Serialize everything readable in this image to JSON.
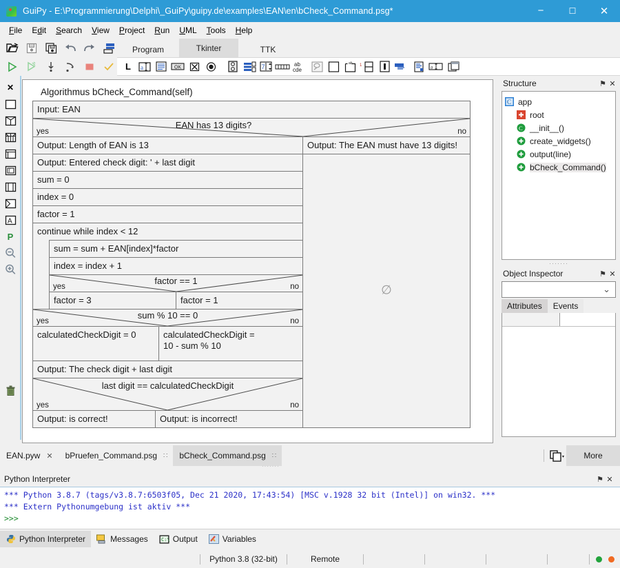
{
  "window": {
    "title": "GuiPy - E:\\Programmierung\\Delphi\\_GuiPy\\guipy.de\\examples\\EAN\\en\\bCheck_Command.psg*",
    "minimize": "─",
    "maximize": "☐",
    "close": "✕"
  },
  "menubar": {
    "items": [
      "File",
      "Edit",
      "Search",
      "View",
      "Project",
      "Run",
      "UML",
      "Tools",
      "Help"
    ]
  },
  "toolbar": {
    "row1": [
      "open-folder-icon",
      "save-icon",
      "save-all-icon",
      "undo-icon",
      "redo-icon",
      "layers-icon"
    ],
    "row2": [
      "run-icon",
      "debug-icon",
      "step-into-icon",
      "step-over-icon",
      "stop-icon",
      "check-icon"
    ]
  },
  "widget_tabs": {
    "items": [
      "Program",
      "Tkinter",
      "TTK"
    ],
    "active": "Tkinter"
  },
  "widget_toolbar": {
    "icons": [
      "label-icon",
      "entry-icon",
      "text-icon",
      "button-icon",
      "checkbox-icon",
      "radiobutton-icon",
      "listbox-icon",
      "scale-icon",
      "spinbox-icon",
      "scrollbar-icon",
      "abcde-icon",
      "canvas-icon",
      "frame-icon",
      "labelframe-icon",
      "panedwindow-icon",
      "notebook-icon",
      "menu-icon",
      "menubutton-icon",
      "combobox-icon",
      "toplevel-icon"
    ]
  },
  "palette": {
    "items": [
      {
        "name": "close-icon",
        "glyph": "✕"
      },
      {
        "name": "statement-block-icon",
        "glyph": "box"
      },
      {
        "name": "if-block-icon",
        "glyph": "if"
      },
      {
        "name": "case-block-icon",
        "glyph": "case"
      },
      {
        "name": "while-block-icon",
        "glyph": "while"
      },
      {
        "name": "for-block-icon",
        "glyph": "for"
      },
      {
        "name": "repeat-block-icon",
        "glyph": "repeat"
      },
      {
        "name": "subprogram-block-icon",
        "glyph": "sub"
      },
      {
        "name": "text-block-icon",
        "glyph": "A"
      },
      {
        "name": "python-mode-icon",
        "glyph": "P"
      },
      {
        "name": "zoom-out-icon",
        "glyph": "zoomout"
      },
      {
        "name": "zoom-in-icon",
        "glyph": "zoomin"
      },
      {
        "name": "delete-icon",
        "glyph": "trash"
      }
    ]
  },
  "diagram": {
    "title": "Algorithmus  bCheck_Command(self)",
    "empty_symbol": "∅",
    "rows": [
      {
        "kind": "stmt",
        "text": "Input: EAN"
      },
      {
        "kind": "decision",
        "cond": "EAN has 13 digits?",
        "yes": "yes",
        "no": "no"
      },
      {
        "kind": "branch_start",
        "left": "Output: Length of EAN is 13",
        "right": "Output: The EAN must have 13 digits!"
      },
      {
        "kind": "stmt",
        "text": "Output: Entered check digit: ' + last digit"
      },
      {
        "kind": "stmt",
        "text": "sum = 0"
      },
      {
        "kind": "stmt",
        "text": "index = 0"
      },
      {
        "kind": "stmt",
        "text": "factor = 1"
      },
      {
        "kind": "loop",
        "text": "continue while index < 12"
      },
      {
        "kind": "stmt_nested",
        "text": "sum = sum + EAN[index]*factor"
      },
      {
        "kind": "stmt_nested",
        "text": "index = index + 1"
      },
      {
        "kind": "decision_nested",
        "cond": "factor == 1",
        "yes": "yes",
        "no": "no"
      },
      {
        "kind": "split_nested",
        "left": "factor = 3",
        "right": "factor = 1"
      },
      {
        "kind": "decision",
        "cond": "sum % 10 == 0",
        "yes": "yes",
        "no": "no"
      },
      {
        "kind": "split",
        "left": "calculatedCheckDigit = 0",
        "right": "calculatedCheckDigit =\n10 - sum % 10"
      },
      {
        "kind": "stmt",
        "text": "Output: The check digit + last digit"
      },
      {
        "kind": "decision_tall",
        "cond": "last digit == calculatedCheckDigit",
        "yes": "yes",
        "no": "no"
      },
      {
        "kind": "split",
        "left": "Output:  is correct!",
        "right": "Output: is incorrect!"
      }
    ],
    "cells": {
      "input_ean": "Input: EAN",
      "cond_digits": "EAN has 13 digits?",
      "yes": "yes",
      "no": "no",
      "len_ok": "Output: Length of EAN is 13",
      "len_bad": "Output: The EAN must have 13 digits!",
      "entered_check": "Output: Entered check digit: ' + last digit",
      "sum0": "sum = 0",
      "index0": "index = 0",
      "factor1": "factor = 1",
      "while_loop": "continue while index < 12",
      "sum_add": "sum = sum + EAN[index]*factor",
      "index_inc": "index = index + 1",
      "cond_factor": "factor == 1",
      "factor3": "factor = 3",
      "factor1b": "factor = 1",
      "cond_mod": "sum % 10 == 0",
      "ccd0": "calculatedCheckDigit = 0",
      "ccd_line1": "calculatedCheckDigit =",
      "ccd_line2": "10 - sum % 10",
      "out_check": "Output: The check digit + last digit",
      "cond_last": "last digit == calculatedCheckDigit",
      "correct": "Output:  is correct!",
      "incorrect": "Output: is incorrect!"
    }
  },
  "structure": {
    "title": "Structure",
    "pin": "⚑",
    "close": "✕",
    "nodes": [
      {
        "label": "app",
        "icon": "class-icon",
        "indent": 0
      },
      {
        "label": "root",
        "icon": "field-icon",
        "indent": 1
      },
      {
        "label": "__init__()",
        "icon": "constructor-icon",
        "indent": 1
      },
      {
        "label": "create_widgets()",
        "icon": "method-icon",
        "indent": 1
      },
      {
        "label": "output(line)",
        "icon": "method-icon",
        "indent": 1
      },
      {
        "label": "bCheck_Command()",
        "icon": "method-icon",
        "indent": 1,
        "selected": true
      }
    ]
  },
  "object_inspector": {
    "title": "Object Inspector",
    "pin": "⚑",
    "close": "✕",
    "combo_value": "",
    "combo_arrow": "⌄",
    "tabs": [
      "Attributes",
      "Events"
    ],
    "active_tab": "Attributes"
  },
  "file_tabs": {
    "tabs": [
      {
        "label": "EAN.pyw",
        "marker": "✕",
        "active": false
      },
      {
        "label": "bPruefen_Command.psg",
        "marker": "∷",
        "active": false
      },
      {
        "label": "bCheck_Command.psg",
        "marker": "∷",
        "active": true
      }
    ],
    "icons": [
      "copy-dropdown-icon",
      "nav-back-icon",
      "nav-forward-icon",
      "new-folder-icon"
    ],
    "more_label": "More"
  },
  "interpreter": {
    "title": "Python Interpreter",
    "pin": "⚑",
    "close": "✕",
    "lines": [
      "*** Python 3.8.7 (tags/v3.8.7:6503f05, Dec 21 2020, 17:43:54) [MSC v.1928 32 bit (Intel)] on win32. ***",
      "*** Extern Pythonumgebung ist aktiv ***",
      ">>>"
    ],
    "tabs": [
      {
        "label": "Python Interpreter",
        "icon": "python-icon",
        "active": true
      },
      {
        "label": "Messages",
        "icon": "messages-icon",
        "active": false
      },
      {
        "label": "Output",
        "icon": "output-icon",
        "active": false
      },
      {
        "label": "Variables",
        "icon": "variables-icon",
        "active": false
      }
    ]
  },
  "statusbar": {
    "python_version": "Python 3.8 (32-bit)",
    "connection": "Remote",
    "indicator_green": "#22a33c",
    "indicator_orange": "#f06a22"
  },
  "colors": {
    "titlebar": "#2e9bd6",
    "chrome": "#f0f0f0",
    "canvas": "#ffffff",
    "diagram_fill": "#f2f2f2",
    "diagram_border": "#7a7a7a",
    "active_tab": "#dcdcdc"
  }
}
